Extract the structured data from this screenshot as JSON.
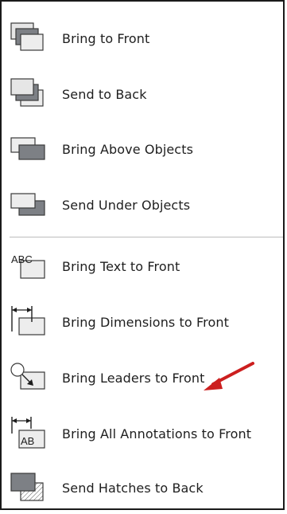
{
  "menu": {
    "items": [
      {
        "label": "Bring to Front",
        "icon": "bring-to-front-icon"
      },
      {
        "label": "Send to Back",
        "icon": "send-to-back-icon"
      },
      {
        "label": "Bring Above Objects",
        "icon": "bring-above-objects-icon"
      },
      {
        "label": "Send Under Objects",
        "icon": "send-under-objects-icon"
      },
      {
        "label": "Bring Text to Front",
        "icon": "bring-text-to-front-icon",
        "icon_text": "ABC"
      },
      {
        "label": "Bring Dimensions to Front",
        "icon": "bring-dimensions-to-front-icon"
      },
      {
        "label": "Bring Leaders to Front",
        "icon": "bring-leaders-to-front-icon"
      },
      {
        "label": "Bring All Annotations to Front",
        "icon": "bring-all-annotations-to-front-icon",
        "icon_text": "AB"
      },
      {
        "label": "Send Hatches to Back",
        "icon": "send-hatches-to-back-icon"
      }
    ]
  },
  "annotation": {
    "color": "#cc1f1f",
    "icon": "red-arrow-pointer"
  },
  "colors": {
    "icon_fill_light": "#e6e6e6",
    "icon_fill_dark": "#7d8085",
    "icon_stroke": "#3a3a3a"
  }
}
